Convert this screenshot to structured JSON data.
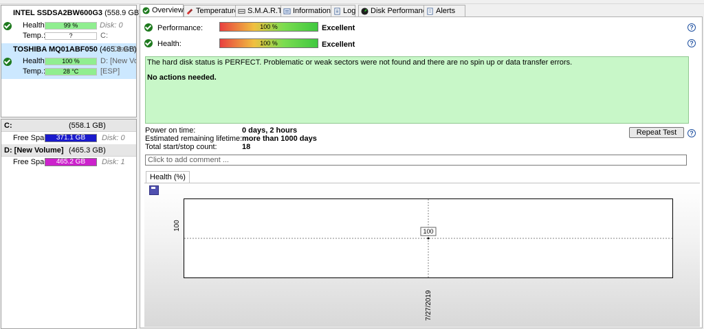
{
  "disks": [
    {
      "name": "INTEL SSDSA2BW600G3",
      "size": "(558.9 GB)",
      "disk_num": "Disk: 0",
      "health_label": "Health:",
      "health": "99 %",
      "health_pct": 99,
      "temp_label": "Temp.:",
      "temp": "?",
      "vol": "C:"
    },
    {
      "name": "TOSHIBA MQ01ABF050",
      "size": "(465.8 GB)",
      "disk_num": "Disk: 1",
      "health_label": "Health:",
      "health": "100 %",
      "health_pct": 100,
      "temp_label": "Temp.:",
      "temp": "28 °C",
      "vol1": "D: [New Volume]",
      "vol2": "[ESP]"
    }
  ],
  "volumes": [
    {
      "name": "C:",
      "size": "(558.1 GB)",
      "free_label": "Free Space",
      "free": "371.1 GB",
      "disk": "Disk: 0",
      "bar_color": "#1a1acc"
    },
    {
      "name": "D: [New Volume]",
      "size": "(465.3 GB)",
      "free_label": "Free Space",
      "free": "465.2 GB",
      "disk": "Disk: 1",
      "bar_color": "#cc22cc"
    }
  ],
  "tabs": [
    {
      "label": "Overview",
      "icon": "check-icon"
    },
    {
      "label": "Temperature",
      "icon": "thermometer-icon"
    },
    {
      "label": "S.M.A.R.T.",
      "icon": "smart-icon"
    },
    {
      "label": "Information",
      "icon": "info-icon"
    },
    {
      "label": "Log",
      "icon": "log-icon"
    },
    {
      "label": "Disk Performance",
      "icon": "performance-icon"
    },
    {
      "label": "Alerts",
      "icon": "alerts-icon"
    }
  ],
  "overview": {
    "performance_label": "Performance:",
    "performance": "100 %",
    "performance_pct": 100,
    "performance_verdict": "Excellent",
    "health_label": "Health:",
    "health": "100 %",
    "health_pct": 100,
    "health_verdict": "Excellent",
    "status_text": "The hard disk status is PERFECT. Problematic or weak sectors were not found and there are no spin up or data transfer errors.",
    "actions_text": "No actions needed.",
    "power_on_label": "Power on time:",
    "power_on": "0 days, 2 hours",
    "lifetime_label": "Estimated remaining lifetime:",
    "lifetime": "more than 1000 days",
    "startstop_label": "Total start/stop count:",
    "startstop": "18",
    "repeat_button": "Repeat Test",
    "comment_placeholder": "Click to add comment ...",
    "help_glyph": "?"
  },
  "chart_data": {
    "type": "line",
    "tab_label": "Health (%)",
    "x": [
      "7/27/2019"
    ],
    "series": [
      {
        "values": [
          100
        ]
      }
    ],
    "data_labels": [
      "100"
    ],
    "ytick_labels": [
      "100"
    ]
  },
  "colors": {
    "accent_green": "#1e7a1e",
    "status_bg": "#c8f7c8",
    "selected_bg": "#cce8ff"
  }
}
